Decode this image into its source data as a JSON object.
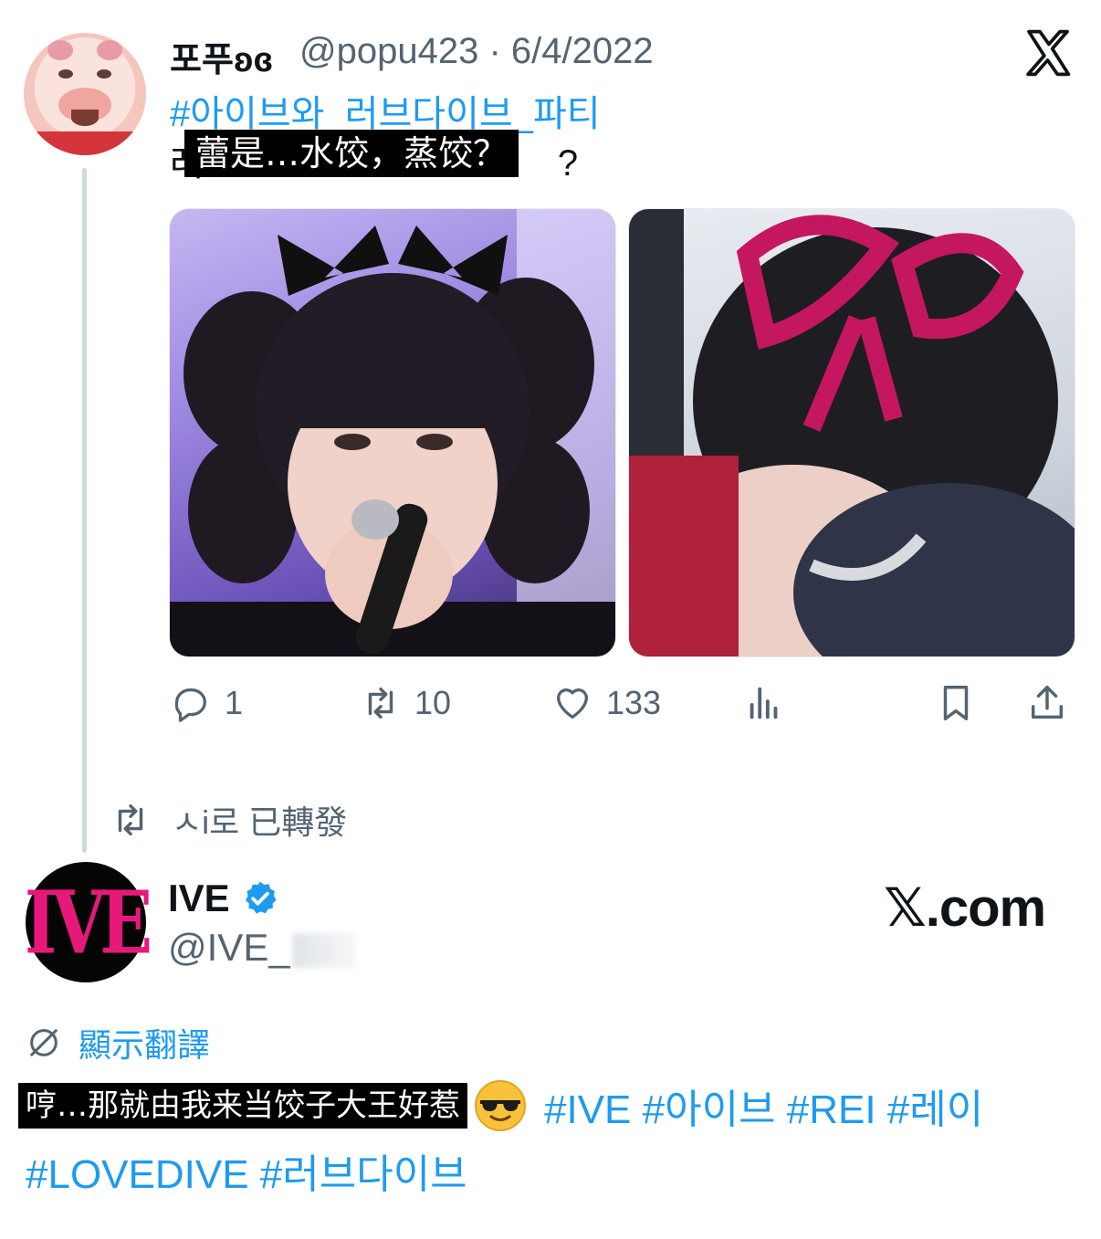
{
  "tweet": {
    "author_name": "포푸ʚɞ",
    "meta": "@popu423 · 6/4/2022",
    "hashtag_line": "#아이브와_러브다이브_파티",
    "original_text_prefix": "레",
    "original_text_suffix": "?",
    "subtitle": "蕾是…水饺，蒸饺？",
    "actions": {
      "replies": "1",
      "retweets": "10",
      "likes": "133"
    }
  },
  "retweet_note": "ㅅi로 已轉發",
  "quoted": {
    "name": "IVE",
    "handle": "@IVE_",
    "avatar_text": "IVE",
    "watermark": "𝕏.com",
    "translate_label": "顯示翻譯",
    "subtitle": "哼…那就由我来当饺子大王好惹",
    "tags_line1": "#IVE #아이브 #REI #레이",
    "tags_line2": "#LOVEDIVE #러브다이브"
  },
  "colors": {
    "link": "#1d9bf0",
    "secondary_text": "#536471",
    "brand_pink": "#e6197a"
  }
}
